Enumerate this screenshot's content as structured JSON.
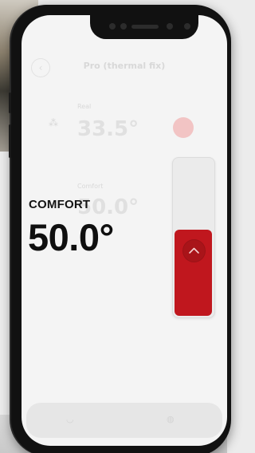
{
  "app": {
    "header_title": "Pro (thermal fix)",
    "back_icon": "back-arrow-icon"
  },
  "faded": {
    "label_1": "Real",
    "value_1": "33.5°",
    "label_2": "Comfort",
    "value_2": "50.0°"
  },
  "mode": {
    "label": "COMFORT",
    "temperature": "50.0°"
  },
  "slider": {
    "level_fraction": 0.55,
    "accent": "#c0171e",
    "icon": "chevron-up-icon"
  },
  "colors": {
    "accent": "#c0171e",
    "text": "#0f0f0f",
    "screen_bg": "#f4f4f4"
  }
}
